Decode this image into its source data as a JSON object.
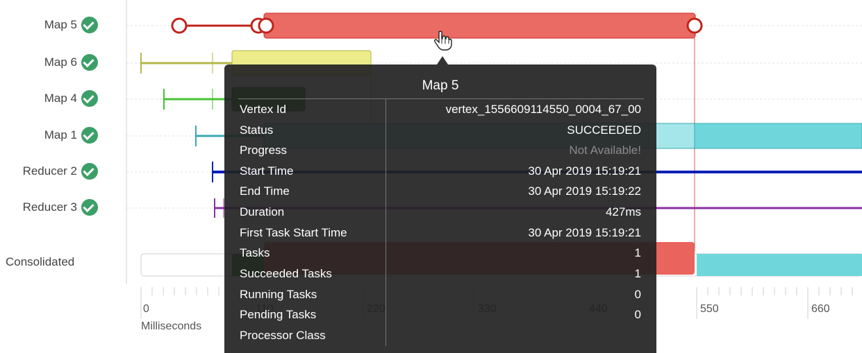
{
  "rows": [
    {
      "label": "Map 5",
      "color": "#cc2a22",
      "status": "succeeded"
    },
    {
      "label": "Map 6",
      "color": "#b5b54a",
      "status": "succeeded"
    },
    {
      "label": "Map 4",
      "color": "#44c236",
      "status": "succeeded"
    },
    {
      "label": "Map 1",
      "color": "#3aa8ad",
      "status": "succeeded"
    },
    {
      "label": "Reducer 2",
      "color": "#0a1fb5",
      "status": "succeeded"
    },
    {
      "label": "Reducer 3",
      "color": "#8a2fa3",
      "status": "succeeded"
    }
  ],
  "consolidated_label": "Consolidated",
  "axis": {
    "title": "Milliseconds",
    "ticks": [
      "0",
      "110",
      "220",
      "330",
      "440",
      "550",
      "660"
    ]
  },
  "tooltip": {
    "title": "Map 5",
    "fields": [
      {
        "key": "Vertex Id",
        "value": "vertex_1556609114550_0004_67_00"
      },
      {
        "key": "Status",
        "value": "SUCCEEDED"
      },
      {
        "key": "Progress",
        "value": "Not Available!"
      },
      {
        "key": "Start Time",
        "value": "30 Apr 2019 15:19:21"
      },
      {
        "key": "End Time",
        "value": "30 Apr 2019 15:19:22"
      },
      {
        "key": "Duration",
        "value": "427ms"
      },
      {
        "key": "First Task Start Time",
        "value": "30 Apr 2019 15:19:21"
      },
      {
        "key": "Tasks",
        "value": "1"
      },
      {
        "key": "Succeeded Tasks",
        "value": "1"
      },
      {
        "key": "Running Tasks",
        "value": "0"
      },
      {
        "key": "Pending Tasks",
        "value": "0"
      },
      {
        "key": "Processor Class",
        "value": ""
      }
    ]
  },
  "icons": {
    "status": "check-circle-icon",
    "cursor": "hand-pointer-icon"
  }
}
